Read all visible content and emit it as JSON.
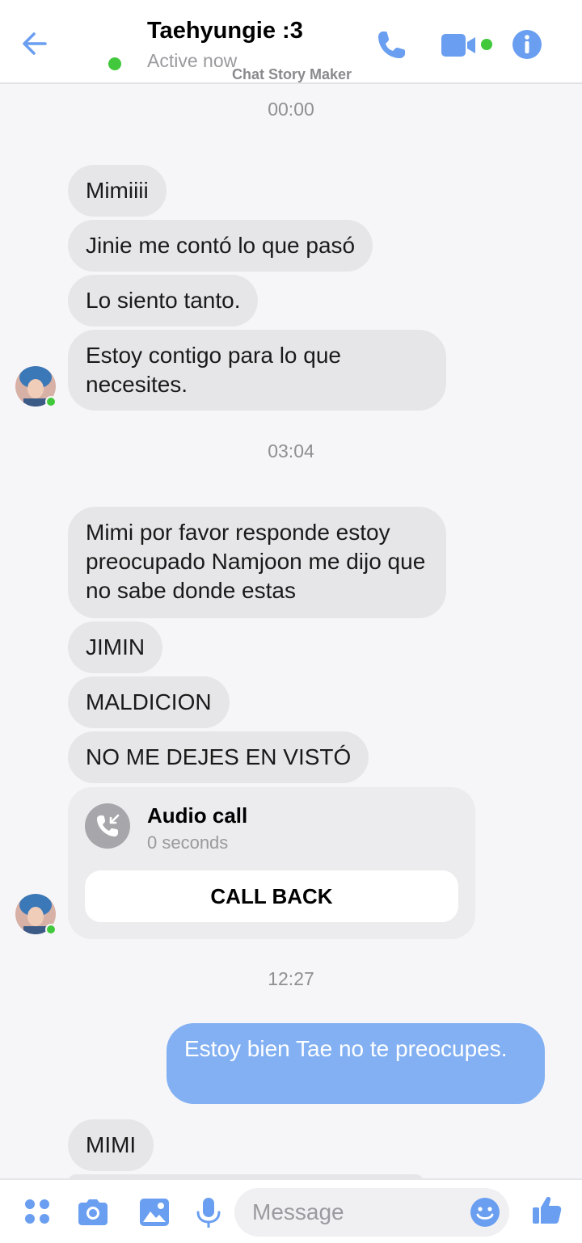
{
  "header": {
    "contact_name": "Taehyungie :3",
    "status": "Active now",
    "watermark": "Chat Story Maker"
  },
  "colors": {
    "accent": "#6a9ef0",
    "online": "#42c83c",
    "incoming_bubble": "#e6e6e8",
    "outgoing_bubble": "#82b0f2"
  },
  "messages": {
    "t1": "00:00",
    "m1": "Mimiiii",
    "m2": "Jinie me contó lo que pasó",
    "m3": "Lo siento tanto.",
    "m4": "Estoy contigo para lo que necesites.",
    "t2": "03:04",
    "m5": "Mimi por favor responde estoy preocupado Namjoon me dijo que no sabe donde estas",
    "m6": "JIMIN",
    "m7": "MALDICION",
    "m8": "NO ME DEJES EN VISTÓ",
    "t3": "12:27",
    "m9": "Estoy bien Tae no te preocupes.",
    "m10": "MIMI"
  },
  "call": {
    "title": "Audio call",
    "duration": "0 seconds",
    "button": "CALL BACK"
  },
  "composer": {
    "placeholder": "Message"
  },
  "icons": [
    "back-arrow-icon",
    "phone-icon",
    "video-camera-icon",
    "info-icon",
    "missed-call-icon",
    "apps-icon",
    "camera-icon",
    "gallery-icon",
    "microphone-icon",
    "emoji-icon",
    "thumbs-up-icon"
  ]
}
